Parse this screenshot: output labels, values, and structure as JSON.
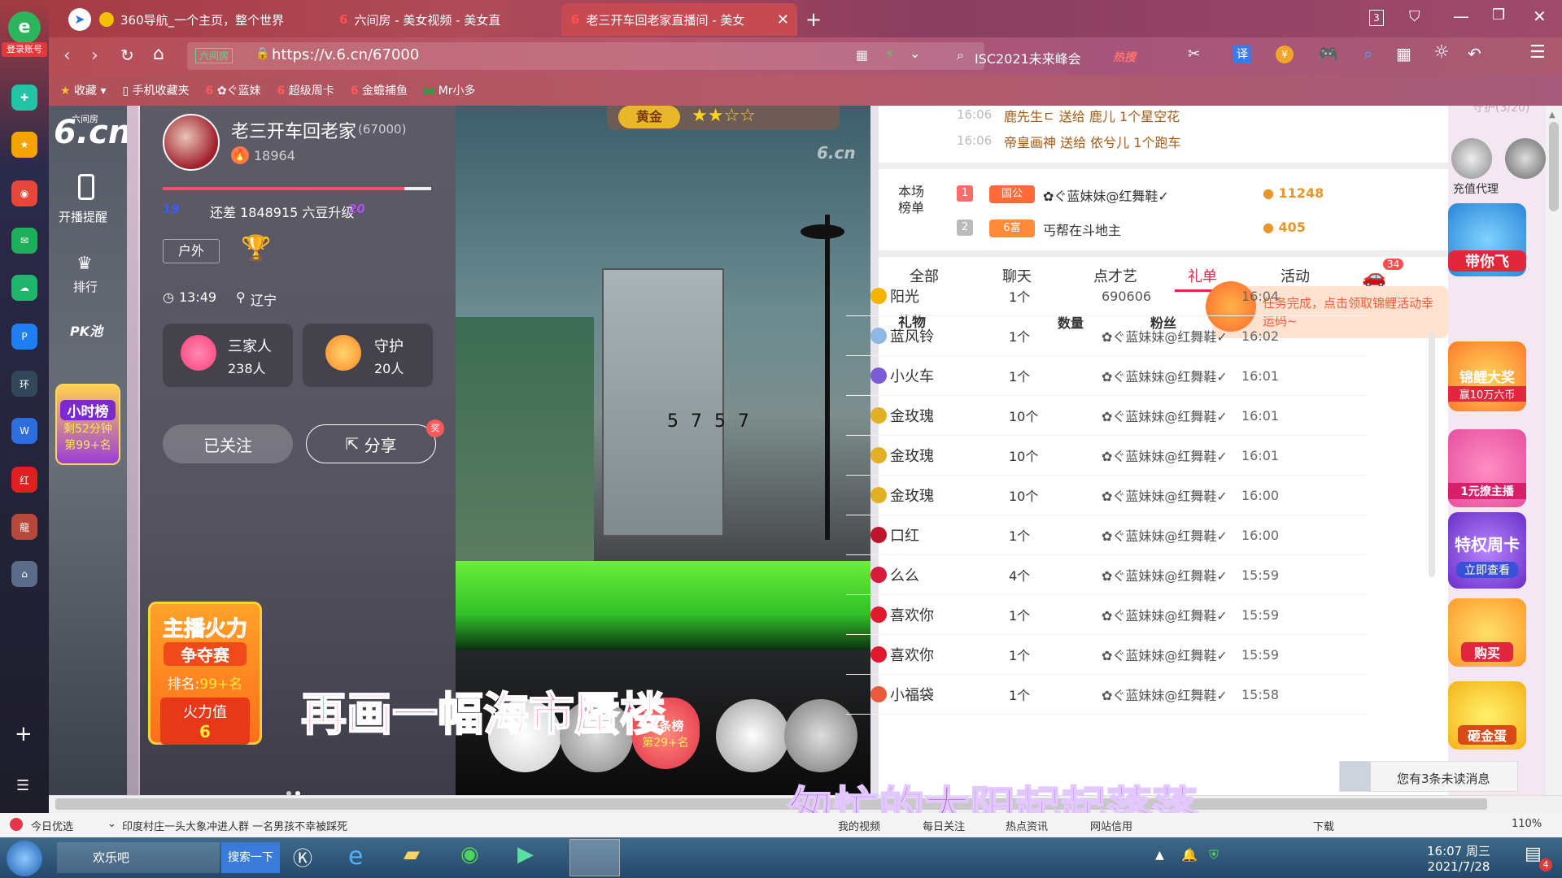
{
  "browser": {
    "tabs": [
      {
        "label": "360导航_一个主页，整个世界"
      },
      {
        "label": "六间房 - 美女视频 - 美女直"
      },
      {
        "label": "老三开车回老家直播间 - 美女"
      }
    ],
    "tab_count": "3",
    "url": "https://v.6.cn/67000",
    "url_site_badge": "六间房",
    "search_text": "ISC2021未来峰会",
    "hot_label": "热搜",
    "translate_label": "译",
    "login_label": "登录账号"
  },
  "bookmarks": [
    {
      "label": "收藏"
    },
    {
      "label": "手机收藏夹"
    },
    {
      "label": "✿ぐ蓝妹"
    },
    {
      "label": "超级周卡"
    },
    {
      "label": "金蟾捕鱼"
    },
    {
      "label": "Mr小多"
    }
  ],
  "site_nav": {
    "logo_small": "六间房",
    "logo_main": "6.cn",
    "items": [
      {
        "label": "开播提醒"
      },
      {
        "label": "排行"
      },
      {
        "label": "PK池"
      }
    ],
    "hourly_rank": {
      "title": "小时榜",
      "line1": "剩52分钟",
      "line2": "第99+名"
    }
  },
  "room": {
    "streamer_name": "老三开车回老家",
    "room_id": "(67000)",
    "heat": "18964",
    "level_from": "19",
    "level_to": "20",
    "level_text": "还差 1848915 六豆升级",
    "tag": "户外",
    "time": "13:49",
    "location": "辽宁",
    "family_label": "三家人",
    "family_count": "238人",
    "guard_label": "守护",
    "guard_count": "20人",
    "follow_label": "已关注",
    "share_label": "分享",
    "share_badge": "奖",
    "fire_contest_title": "主播火力",
    "fire_contest_sub": "争夺赛",
    "fire_rank_label": "排名:",
    "fire_rank_value": "99+名",
    "fire_value_label": "火力值",
    "fire_value": "6"
  },
  "video": {
    "watermark": "6.cn",
    "plate_text": "5 7 5 7",
    "gold_badge": "黄金",
    "subtitle_1": "再画一幅海市蜃楼",
    "subtitle_2": "匆忙的太阳起起落落",
    "headline_badge": "头条榜",
    "headline_rank": "第29+名"
  },
  "chat": {
    "messages": [
      {
        "time": "16:06",
        "text": "鹿先生ㄷ 送给 鹿儿 1个星空花"
      },
      {
        "time": "16:06",
        "text": "帝皇画神 送给 依兮儿 1个跑车"
      }
    ]
  },
  "ranking": {
    "label": "本场榜单",
    "rows": [
      {
        "rank": "1",
        "badge": "国公",
        "name": "✿ぐ蓝妹妹@红舞鞋✓",
        "score": "11248"
      },
      {
        "rank": "2",
        "badge": "6富",
        "name": "丐帮在斗地主",
        "score": "405"
      }
    ]
  },
  "tabs": {
    "items": [
      "全部",
      "聊天",
      "点才艺",
      "礼单",
      "活动"
    ],
    "active": "礼单",
    "badge": "34"
  },
  "task_tip": "任务完成，点击领取锦鲤活动幸运码~",
  "gift_table": {
    "headers": [
      "礼物",
      "数量",
      "粉丝"
    ],
    "rows": [
      {
        "gift": "阳光",
        "qty": "1个",
        "fan": "690606",
        "time": "16:04",
        "color": "#f5b400"
      },
      {
        "gift": "蓝风铃",
        "qty": "1个",
        "fan": "✿ぐ蓝妹妹@红舞鞋✓",
        "time": "16:02",
        "color": "#8fb7e6"
      },
      {
        "gift": "小火车",
        "qty": "1个",
        "fan": "✿ぐ蓝妹妹@红舞鞋✓",
        "time": "16:01",
        "color": "#7b5cd6"
      },
      {
        "gift": "金玫瑰",
        "qty": "10个",
        "fan": "✿ぐ蓝妹妹@红舞鞋✓",
        "time": "16:01",
        "color": "#e2b022"
      },
      {
        "gift": "金玫瑰",
        "qty": "10个",
        "fan": "✿ぐ蓝妹妹@红舞鞋✓",
        "time": "16:01",
        "color": "#e2b022"
      },
      {
        "gift": "金玫瑰",
        "qty": "10个",
        "fan": "✿ぐ蓝妹妹@红舞鞋✓",
        "time": "16:00",
        "color": "#e2b022"
      },
      {
        "gift": "口红",
        "qty": "1个",
        "fan": "✿ぐ蓝妹妹@红舞鞋✓",
        "time": "16:00",
        "color": "#c0132c"
      },
      {
        "gift": "么么",
        "qty": "4个",
        "fan": "✿ぐ蓝妹妹@红舞鞋✓",
        "time": "15:59",
        "color": "#d81b3c"
      },
      {
        "gift": "喜欢你",
        "qty": "1个",
        "fan": "✿ぐ蓝妹妹@红舞鞋✓",
        "time": "15:59",
        "color": "#e0192f"
      },
      {
        "gift": "喜欢你",
        "qty": "1个",
        "fan": "✿ぐ蓝妹妹@红舞鞋✓",
        "time": "15:59",
        "color": "#e0192f"
      },
      {
        "gift": "小福袋",
        "qty": "1个",
        "fan": "✿ぐ蓝妹妹@红舞鞋✓",
        "time": "15:58",
        "color": "#e85a3a"
      }
    ]
  },
  "side_panel": {
    "guard_header": "守护(3/20)",
    "items": [
      {
        "label": "充值代理"
      },
      {
        "label": "带你飞"
      },
      {
        "label": "锦鲤大奖"
      },
      {
        "label": "赢10万六币"
      },
      {
        "label": "1元撩主播"
      },
      {
        "label": "特权周卡"
      },
      {
        "label": "立即查看"
      },
      {
        "label": "购买"
      },
      {
        "label": "砸金蛋"
      }
    ],
    "unread_text": "您有3条未读消息",
    "unread_count": "3"
  },
  "status_bar": {
    "news_label": "今日优选",
    "news_text": "印度村庄一头大象冲进人群 一名男孩不幸被踩死",
    "items": [
      "我的视频",
      "每日关注",
      "热点资讯",
      "网站信用",
      "下载"
    ],
    "zoom": "110%"
  },
  "taskbar": {
    "app_label": "欢乐吧",
    "search_btn": "搜索一下",
    "clock_time": "16:07 周三",
    "clock_date": "2021/7/28",
    "notif": "4"
  }
}
